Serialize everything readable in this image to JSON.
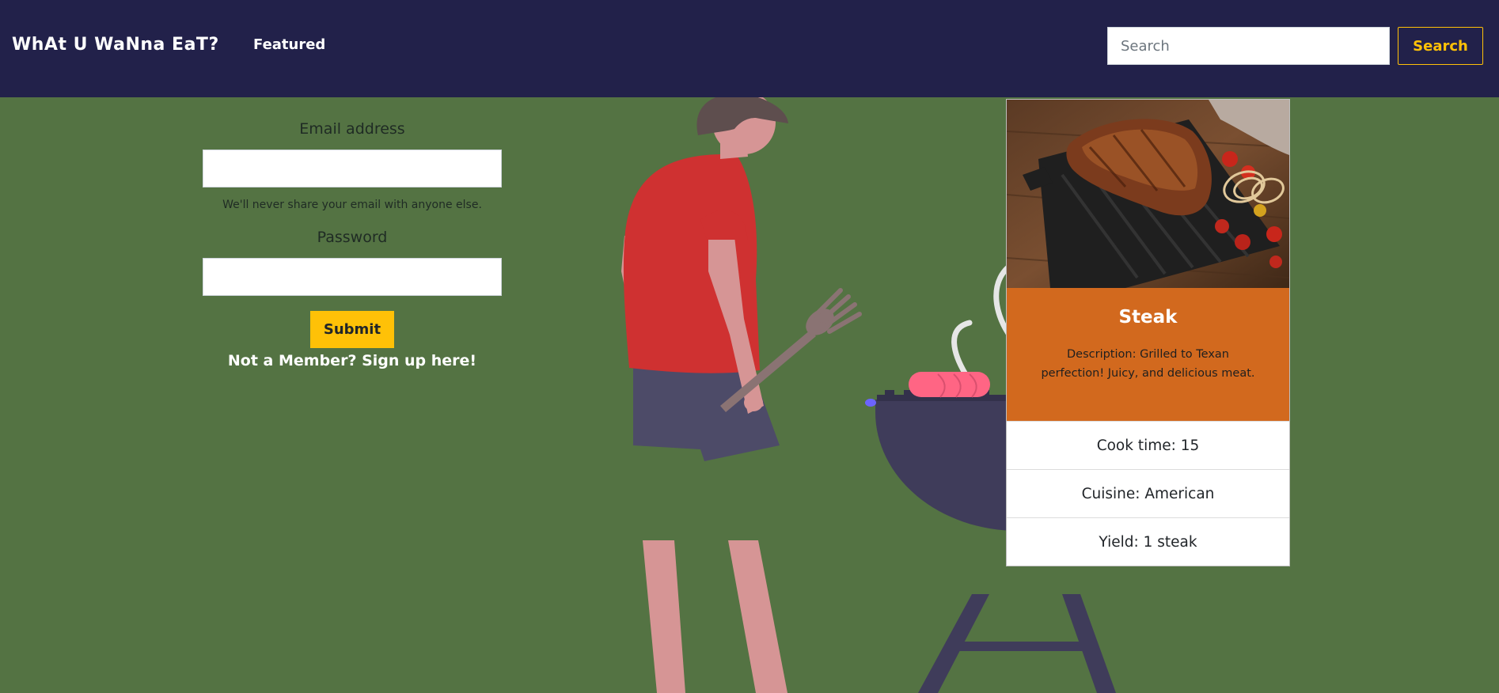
{
  "navbar": {
    "brand": "WhAt U WaNna EaT?",
    "featured_label": "Featured",
    "search_placeholder": "Search",
    "search_button": "Search"
  },
  "login_form": {
    "email_label": "Email address",
    "email_value": "",
    "email_help": "We'll never share your email with anyone else.",
    "password_label": "Password",
    "password_value": "",
    "submit_label": "Submit",
    "signup_text": "Not a Member? Sign up here!"
  },
  "recipe_card": {
    "title": "Steak",
    "description": "Description: Grilled to Texan perfection! Juicy, and delicious meat.",
    "details": [
      "Cook time: 15",
      "Cuisine: American",
      "Yield: 1 steak"
    ]
  },
  "colors": {
    "navbar_bg": "#22214a",
    "main_bg": "#547343",
    "accent": "#ffc107",
    "card_body": "#d2691e"
  },
  "icons": {
    "illustration": "man-grilling-illustration",
    "card_image": "steak-photo"
  }
}
